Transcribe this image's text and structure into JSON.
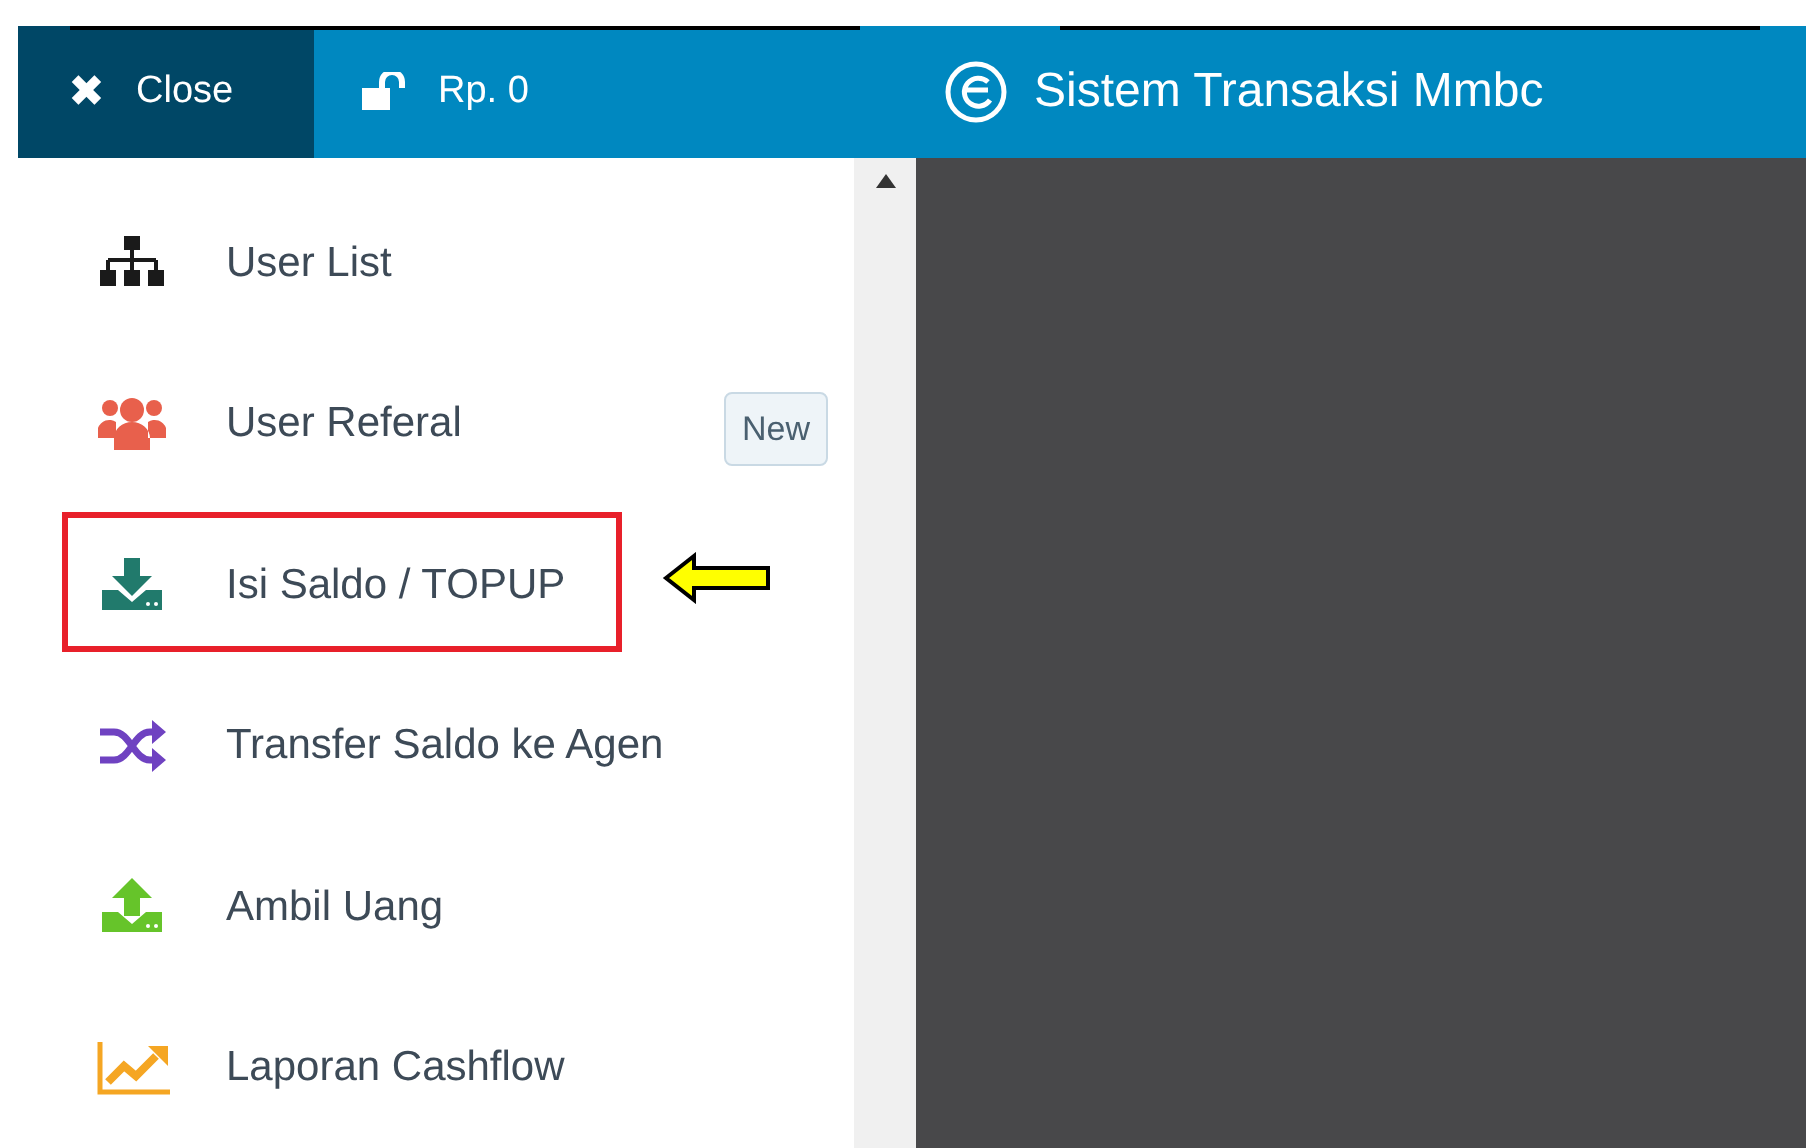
{
  "header": {
    "close_label": "Close",
    "close_icon": "✖",
    "balance": "Rp. 0",
    "title": "Sistem Transaksi Mmbc"
  },
  "menu": [
    {
      "label": "User List",
      "color": "#1a1a1a",
      "highlighted": false
    },
    {
      "label": "User Referal",
      "color": "#e8604c",
      "highlighted": false,
      "badge": "New"
    },
    {
      "label": "Isi Saldo / TOPUP",
      "color": "#217a6c",
      "highlighted": true
    },
    {
      "label": "Transfer Saldo ke Agen",
      "color": "#6f42c1",
      "highlighted": false
    },
    {
      "label": "Ambil Uang",
      "color": "#66c42a",
      "highlighted": false
    },
    {
      "label": "Laporan Cashflow",
      "color": "#f5a623",
      "highlighted": false
    }
  ]
}
